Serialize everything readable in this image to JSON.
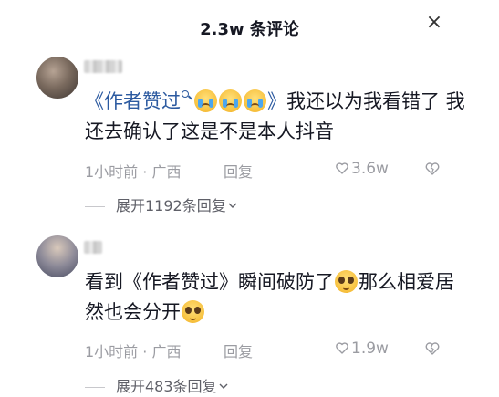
{
  "header": {
    "title": "2.3w 条评论",
    "close_symbol": "×"
  },
  "comments": [
    {
      "text_book_open": "《作者赞过",
      "text_book_close": "》",
      "emojis": [
        "cry-emoji",
        "cry-emoji",
        "cry-emoji"
      ],
      "text_after": "我还以为我看错了 我还去确认了这是不是本人抖音",
      "time_location": "1小时前 · 广西",
      "reply_label": "回复",
      "likes": "3.6w",
      "expand_label": "展开1192条回复"
    },
    {
      "text_before": "看到",
      "text_book": "《作者赞过》",
      "text_middle": "瞬间破防了",
      "text_after_emoji": "那么相爱居然也会分开",
      "emoji": "pleading-emoji",
      "time_location": "1小时前 · 广西",
      "reply_label": "回复",
      "likes": "1.9w",
      "expand_label": "展开483条回复"
    }
  ],
  "colors": {
    "link": "#2c5aa0",
    "meta": "#9b9ca2",
    "text": "#161823"
  }
}
